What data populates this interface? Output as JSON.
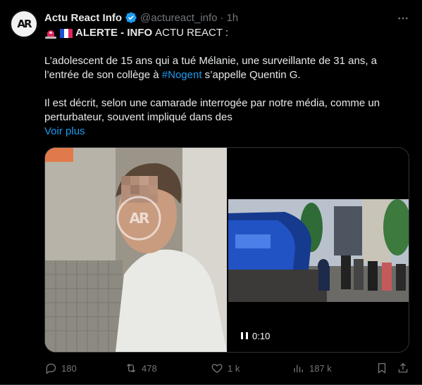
{
  "author": {
    "name": "Actu React Info",
    "handle": "@actureact_info",
    "separator": "·",
    "time": "1h",
    "avatar_text": "AR"
  },
  "tweet": {
    "alert_bold": "ALERTE - INFO",
    "alert_normal": "ACTU REACT :",
    "p1_line1": "L’adolescent de 15 ans qui a tué Mélanie, une surveillante de 31 ans, a",
    "p1_line2_before": "l’entrée de son collège à ",
    "p1_hashtag": "#Nogent",
    "p1_line2_after": " s’appelle Quentin G.",
    "p2_line1": "Il est décrit, selon une camarade interrogée par notre média, comme un",
    "p2_line2": "perturbateur, souvent impliqué dans des",
    "show_more": "Voir plus"
  },
  "media": {
    "watermark": "AR",
    "video_time": "0:10"
  },
  "actions": {
    "replies": "180",
    "reposts": "478",
    "likes": "1 k",
    "views": "187 k"
  },
  "icons": {
    "verified": "verified-badge-icon",
    "more": "more-horizontal-icon",
    "reply": "reply-icon",
    "repost": "repost-icon",
    "like": "heart-icon",
    "views": "views-chart-icon",
    "bookmark": "bookmark-icon",
    "share": "share-icon"
  },
  "colors": {
    "background": "#000000",
    "text": "#e7e9ea",
    "muted": "#71767b",
    "accent": "#1d9bf0"
  }
}
